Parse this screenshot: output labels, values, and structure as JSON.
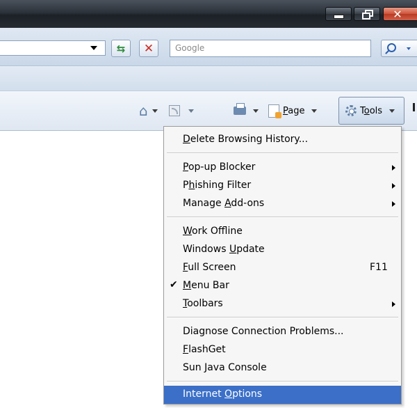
{
  "search": {
    "placeholder": "Google"
  },
  "commandbar": {
    "page_label_pre": "",
    "page_label_ul": "P",
    "page_label_post": "age",
    "tools_label_pre": "T",
    "tools_label_ul": "o",
    "tools_label_post": "ols"
  },
  "menu": {
    "items": [
      {
        "pre": "",
        "ul": "D",
        "post": "elete Browsing History..."
      },
      {
        "pre": "",
        "ul": "P",
        "post": "op-up Blocker"
      },
      {
        "pre": "P",
        "ul": "h",
        "post": "ishing Filter"
      },
      {
        "pre": "Manage ",
        "ul": "A",
        "post": "dd-ons"
      },
      {
        "pre": "",
        "ul": "W",
        "post": "ork Offline"
      },
      {
        "pre": "Windows ",
        "ul": "U",
        "post": "pdate"
      },
      {
        "pre": "",
        "ul": "F",
        "post": "ull Screen",
        "shortcut": "F11"
      },
      {
        "pre": "",
        "ul": "M",
        "post": "enu Bar",
        "check": "✔"
      },
      {
        "pre": "",
        "ul": "T",
        "post": "oolbars"
      },
      {
        "pre": "Diagnose Connection Problems...",
        "ul": "",
        "post": ""
      },
      {
        "pre": "",
        "ul": "F",
        "post": "lashGet"
      },
      {
        "pre": "Sun Java Console",
        "ul": "",
        "post": ""
      },
      {
        "pre": "Internet ",
        "ul": "O",
        "post": "ptions"
      }
    ]
  },
  "colors": {
    "highlight": "#3b6fc8",
    "titlebar": "#2c323a",
    "close": "#c84a32"
  },
  "icons": [
    "home-icon",
    "feeds-icon",
    "print-icon",
    "page-icon",
    "gear-icon",
    "refresh-icon",
    "stop-icon",
    "search-icon"
  ]
}
